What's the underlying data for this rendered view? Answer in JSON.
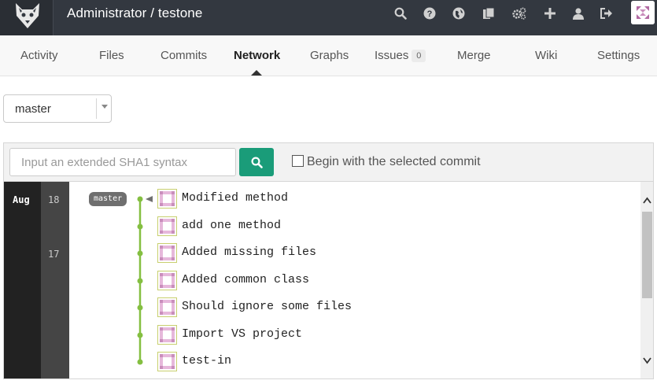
{
  "header": {
    "title": "Administrator / testone",
    "icons": [
      "search-icon",
      "help-icon",
      "explore-icon",
      "snippets-icon",
      "admin-settings-icon",
      "new-icon",
      "profile-icon",
      "logout-icon"
    ]
  },
  "tabs": [
    {
      "label": "Activity",
      "active": false
    },
    {
      "label": "Files",
      "active": false
    },
    {
      "label": "Commits",
      "active": false
    },
    {
      "label": "Network",
      "active": true
    },
    {
      "label": "Graphs",
      "active": false
    },
    {
      "label": "Issues",
      "badge": "0",
      "active": false
    },
    {
      "label": "Merge",
      "active": false
    },
    {
      "label": "Wiki",
      "active": false
    },
    {
      "label": "Settings",
      "active": false
    }
  ],
  "branch_select": {
    "value": "master"
  },
  "search": {
    "placeholder": "Input an extended SHA1 syntax",
    "checkbox_label": "Begin with the selected commit",
    "checked": false
  },
  "graph": {
    "month": "Aug",
    "days": [
      "18",
      "17"
    ],
    "branch_tag": "master",
    "commits": [
      {
        "message": "Modified method"
      },
      {
        "message": "add one method"
      },
      {
        "message": "Added missing files"
      },
      {
        "message": "Added common class"
      },
      {
        "message": "Should ignore some files"
      },
      {
        "message": "Import VS project"
      },
      {
        "message": "test-in"
      }
    ]
  },
  "colors": {
    "header_bg": "#333840",
    "accent_green": "#1a9c79",
    "graph_line": "#84bf41"
  }
}
